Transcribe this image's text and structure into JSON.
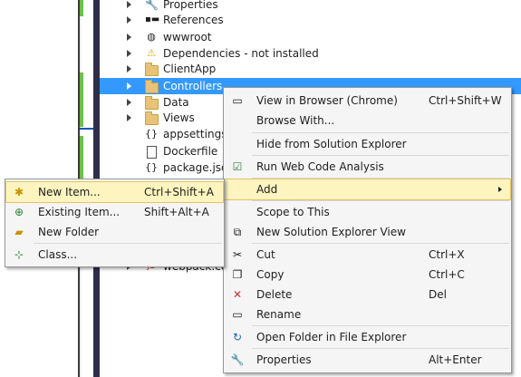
{
  "tree": {
    "items": [
      {
        "label": "Properties",
        "icon": "wrench-icon"
      },
      {
        "label": "References",
        "icon": "references-icon"
      },
      {
        "label": "wwwroot",
        "icon": "globe-icon"
      },
      {
        "label": "Dependencies - not installed",
        "icon": "warning-icon"
      },
      {
        "label": "ClientApp",
        "icon": "folder-icon"
      },
      {
        "label": "Controllers",
        "icon": "folder-icon"
      },
      {
        "label": "Data",
        "icon": "folder-icon"
      },
      {
        "label": "Views",
        "icon": "folder-icon"
      },
      {
        "label": "appsettings.",
        "icon": "json-file-icon"
      },
      {
        "label": "Dockerfile",
        "icon": "file-icon"
      },
      {
        "label": "package.json",
        "icon": "json-file-icon"
      },
      {
        "label": "webpack.con",
        "icon": "js-file-icon"
      }
    ]
  },
  "context_menu": {
    "items": [
      {
        "label": "View in Browser (Chrome)",
        "shortcut": "Ctrl+Shift+W",
        "icon": "browser-icon"
      },
      {
        "label": "Browse With...",
        "shortcut": "",
        "icon": ""
      },
      {
        "label": "Hide from Solution Explorer",
        "shortcut": "",
        "icon": ""
      },
      {
        "label": "Run Web Code Analysis",
        "shortcut": "",
        "icon": "code-analysis-icon"
      },
      {
        "label": "Add",
        "shortcut": "",
        "icon": ""
      },
      {
        "label": "Scope to This",
        "shortcut": "",
        "icon": ""
      },
      {
        "label": "New Solution Explorer View",
        "shortcut": "",
        "icon": "new-view-icon"
      },
      {
        "label": "Cut",
        "shortcut": "Ctrl+X",
        "icon": "scissors-icon"
      },
      {
        "label": "Copy",
        "shortcut": "Ctrl+C",
        "icon": "copy-icon"
      },
      {
        "label": "Delete",
        "shortcut": "Del",
        "icon": "delete-x-icon"
      },
      {
        "label": "Rename",
        "shortcut": "",
        "icon": "rename-icon"
      },
      {
        "label": "Open Folder in File Explorer",
        "shortcut": "",
        "icon": "refresh-icon"
      },
      {
        "label": "Properties",
        "shortcut": "Alt+Enter",
        "icon": "wrench-icon"
      }
    ]
  },
  "add_submenu": {
    "items": [
      {
        "label": "New Item...",
        "shortcut": "Ctrl+Shift+A",
        "icon": "new-item-icon"
      },
      {
        "label": "Existing Item...",
        "shortcut": "Shift+Alt+A",
        "icon": "existing-item-icon"
      },
      {
        "label": "New Folder",
        "shortcut": "",
        "icon": "new-folder-icon"
      },
      {
        "label": "Class...",
        "shortcut": "",
        "icon": "class-icon"
      }
    ]
  },
  "colors": {
    "selection": "#3399ff",
    "menu_highlight": "#fdf4bf",
    "delete_red": "#d32f2f"
  }
}
